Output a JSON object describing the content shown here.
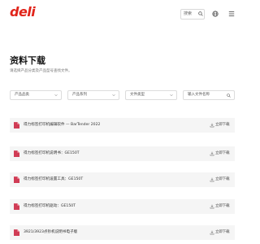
{
  "header": {
    "logo_text": "deli",
    "search_placeholder": "搜索",
    "brand_color": "#e1251b",
    "icons": [
      "search-icon",
      "globe-icon",
      "menu-icon"
    ]
  },
  "page": {
    "title": "资料下载",
    "subtitle": "请选择产品分类及产品型号查找文件。"
  },
  "filters": [
    {
      "label": "产品品类"
    },
    {
      "label": "产品系列"
    },
    {
      "label": "文件类型"
    },
    {
      "label": "输入文件名称"
    }
  ],
  "downloads": {
    "action_label": "立即下载",
    "items": [
      {
        "title": "得力标签打印机编辑软件 — BarTender 2022"
      },
      {
        "title": "得力标签打印机说明书：GE150T"
      },
      {
        "title": "得力标签打印机设置工具：GE150T"
      },
      {
        "title": "得力标签打印机驱动：GE150T"
      },
      {
        "title": "3921/3923点钞机说明书电子版"
      }
    ]
  }
}
